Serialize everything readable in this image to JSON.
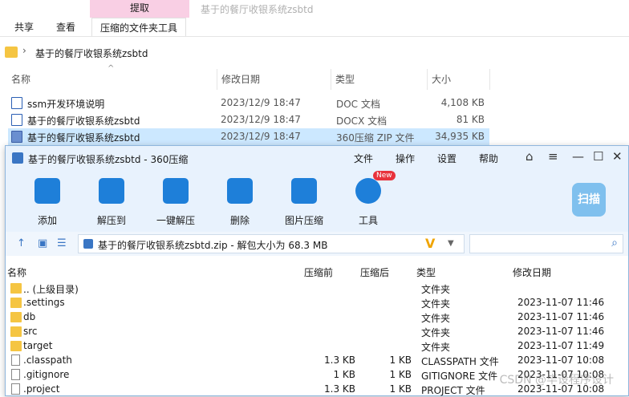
{
  "explorer": {
    "context_tab": "提取",
    "window_title": "基于的餐厅收银系统zsbtd",
    "tabs": [
      "共享",
      "查看",
      "压缩的文件夹工具"
    ],
    "address": "基于的餐厅收银系统zsbtd",
    "columns": [
      "名称",
      "修改日期",
      "类型",
      "大小"
    ],
    "files": [
      {
        "name": "ssm开发环境说明",
        "date": "2023/12/9 18:47",
        "type": "DOC 文档",
        "size": "4,108 KB",
        "icon": "word-doc-icon"
      },
      {
        "name": "基于的餐厅收银系统zsbtd",
        "date": "2023/12/9 18:47",
        "type": "DOCX 文档",
        "size": "81 KB",
        "icon": "word-docx-icon"
      },
      {
        "name": "基于的餐厅收银系统zsbtd",
        "date": "2023/12/9 18:47",
        "type": "360压缩 ZIP 文件",
        "size": "34,935 KB",
        "icon": "zip-archive-icon"
      }
    ]
  },
  "zip": {
    "title": "基于的餐厅收银系统zsbtd - 360压缩",
    "menu": [
      "文件",
      "操作",
      "设置",
      "帮助"
    ],
    "tools": [
      "添加",
      "解压到",
      "一键解压",
      "删除",
      "图片压缩",
      "工具"
    ],
    "new_badge": "New",
    "scan_label": "扫描",
    "path_text": "基于的餐厅收银系统zsbtd.zip - 解包大小为 68.3 MB",
    "columns": [
      "名称",
      "压缩前",
      "压缩后",
      "类型",
      "修改日期"
    ],
    "rows": [
      {
        "name": ".. (上级目录)",
        "before": "",
        "after": "",
        "type": "文件夹",
        "date": "",
        "kind": "folder"
      },
      {
        "name": ".settings",
        "before": "",
        "after": "",
        "type": "文件夹",
        "date": "2023-11-07 11:46",
        "kind": "folder"
      },
      {
        "name": "db",
        "before": "",
        "after": "",
        "type": "文件夹",
        "date": "2023-11-07 11:46",
        "kind": "folder"
      },
      {
        "name": "src",
        "before": "",
        "after": "",
        "type": "文件夹",
        "date": "2023-11-07 11:46",
        "kind": "folder"
      },
      {
        "name": "target",
        "before": "",
        "after": "",
        "type": "文件夹",
        "date": "2023-11-07 11:49",
        "kind": "folder"
      },
      {
        "name": ".classpath",
        "before": "1.3 KB",
        "after": "1 KB",
        "type": "CLASSPATH 文件",
        "date": "2023-11-07 10:08",
        "kind": "file"
      },
      {
        "name": ".gitignore",
        "before": "1 KB",
        "after": "1 KB",
        "type": "GITIGNORE 文件",
        "date": "2023-11-07 10:08",
        "kind": "file"
      },
      {
        "name": ".project",
        "before": "1.3 KB",
        "after": "1 KB",
        "type": "PROJECT 文件",
        "date": "2023-11-07 10:08",
        "kind": "file"
      }
    ]
  },
  "watermark": "CSDN @毕设程序设计"
}
